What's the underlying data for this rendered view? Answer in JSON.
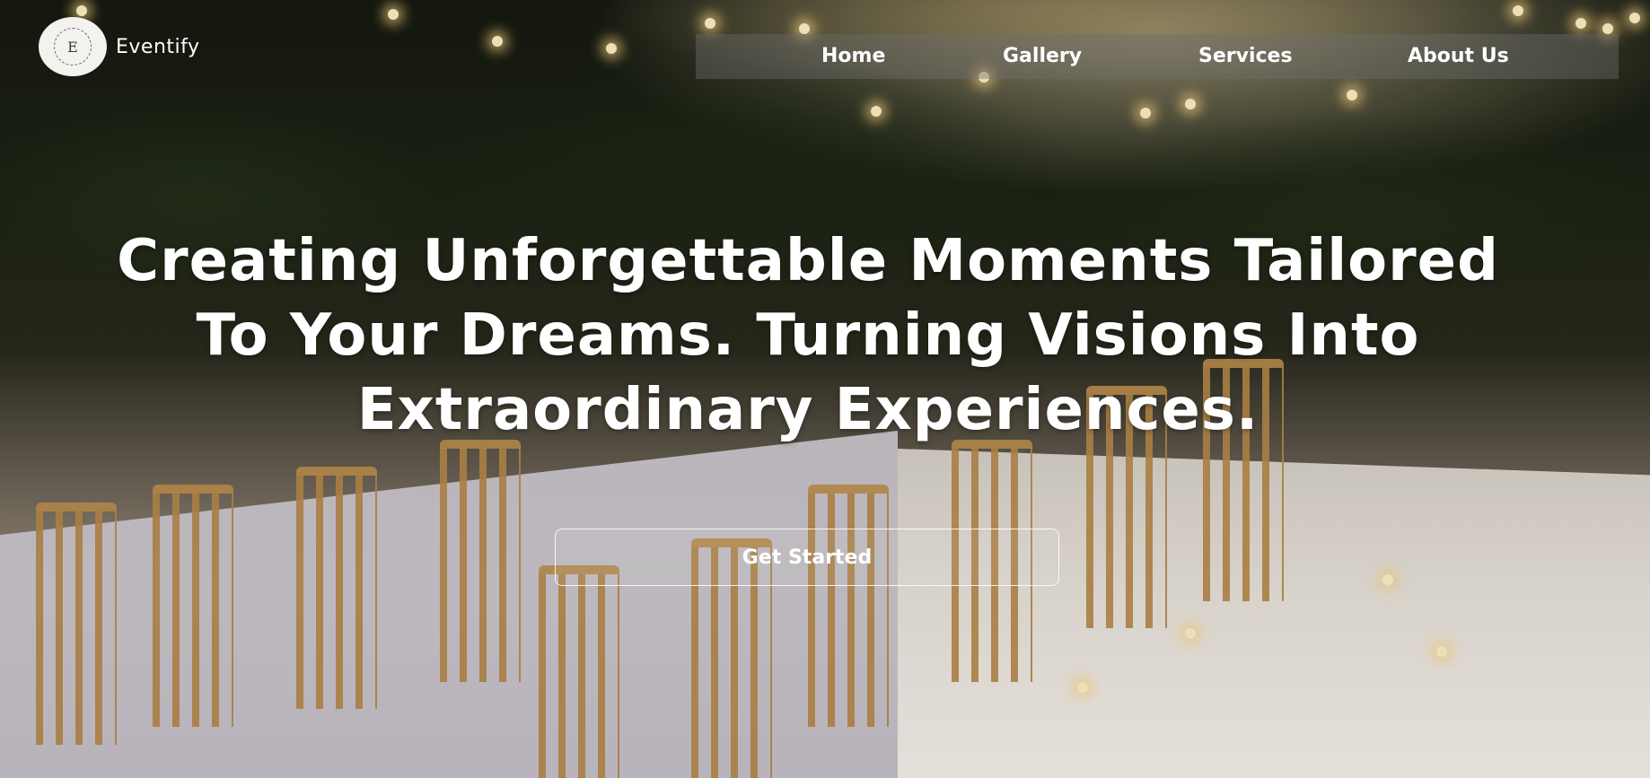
{
  "brand": {
    "logo_letter": "E",
    "name": "Eventify"
  },
  "nav": {
    "items": [
      {
        "label": "Home"
      },
      {
        "label": "Gallery"
      },
      {
        "label": "Services"
      },
      {
        "label": "About Us"
      }
    ]
  },
  "hero": {
    "headline": "Creating Unforgettable Moments Tailored To Your Dreams. Turning Visions Into Extraordinary Experiences.",
    "cta_label": "Get Started"
  },
  "colors": {
    "text": "#ffffff",
    "nav_background": "rgba(110,110,110,0.42)",
    "logo_background": "#f4f2ef"
  }
}
